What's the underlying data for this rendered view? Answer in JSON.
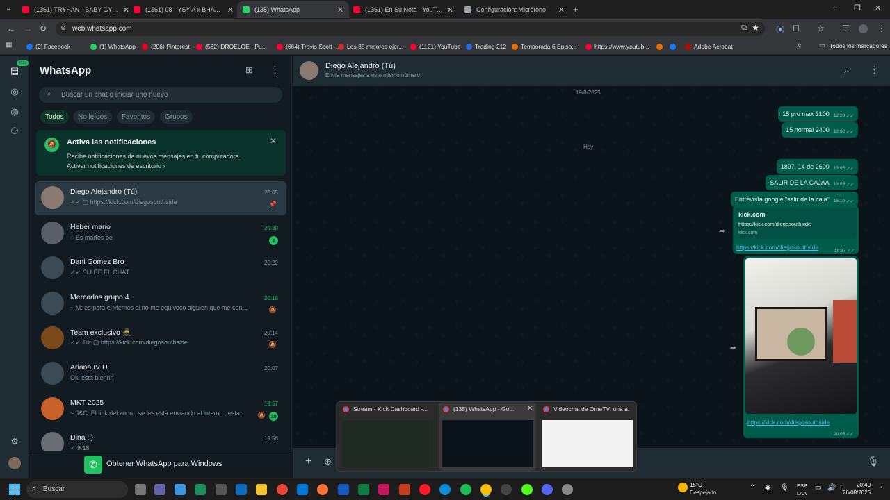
{
  "browser": {
    "tabs": [
      {
        "title": "(1361) TRYHAN - BABY GYAL F",
        "icon": "youtube-icon",
        "color": "#ff0033"
      },
      {
        "title": "(1361) 08 - YSY A x BHAVI ft. M",
        "icon": "youtube-icon",
        "color": "#ff0033"
      },
      {
        "title": "(135) WhatsApp",
        "icon": "whatsapp-icon",
        "color": "#25d366"
      },
      {
        "title": "(1361) En Su Nota - YouTub",
        "icon": "youtube-icon",
        "color": "#ff0033"
      },
      {
        "title": "Configuración: Micrófono",
        "icon": "settings-icon",
        "color": "#9aa0a6"
      }
    ],
    "new_tab": "+",
    "url": "web.whatsapp.com",
    "bookmarks": [
      {
        "label": "(2) Facebook",
        "color": "#1877f2"
      },
      {
        "label": "(1) WhatsApp",
        "color": "#25d366"
      },
      {
        "label": "(206) Pinterest",
        "color": "#e60023"
      },
      {
        "label": "(582) DROELOE - Pu...",
        "color": "#ff0033"
      },
      {
        "label": "(664) Travis Scott -...",
        "color": "#ff0033"
      },
      {
        "label": "Los 35 mejores ejer...",
        "color": "#c4302b"
      },
      {
        "label": "(1121) YouTube",
        "color": "#ff0033"
      },
      {
        "label": "Trading 212",
        "color": "#2d6be4"
      },
      {
        "label": "Temporada 6 Episo...",
        "color": "#e8710a"
      },
      {
        "label": "https://www.youtub...",
        "color": "#ff0033"
      },
      {
        "label": "",
        "color": "#e8710a"
      },
      {
        "label": "",
        "color": "#1877f2"
      },
      {
        "label": "Adobe Acrobat",
        "color": "#b30b00"
      }
    ],
    "bookmarks_more": "»",
    "all_bookmarks": "Todos los marcadores"
  },
  "rail": {
    "badge": "Más"
  },
  "sidebar": {
    "title": "WhatsApp",
    "search_placeholder": "Buscar un chat o iniciar uno nuevo",
    "filters": [
      "Todos",
      "No leídos",
      "Favoritos",
      "Grupos"
    ],
    "notification": {
      "title": "Activa las notificaciones",
      "body": "Recibe notificaciones de nuevos mensajes en tu computadora.",
      "link": "Activar notificaciones de escritorio"
    },
    "chats": [
      {
        "name": "Diego Alejandro (Tú)",
        "preview": "✓✓ ▢ https://kick.com/diegosouthside",
        "time": "20:05",
        "time_green": false,
        "badge": "",
        "muted": false,
        "pinned": true,
        "avatar": "#8a7a72"
      },
      {
        "name": "Heber mano",
        "preview": "◌ Es martes oe",
        "time": "20:30",
        "time_green": true,
        "badge": "2",
        "muted": false,
        "pinned": false,
        "avatar": "#5a5f6a"
      },
      {
        "name": "Dani Gomez Bro",
        "preview": "✓✓ SI LEE EL CHAT",
        "time": "20:22",
        "time_green": false,
        "badge": "",
        "muted": false,
        "pinned": false,
        "avatar": "#3b4a54"
      },
      {
        "name": "Mercados grupo 4",
        "preview": "~ M: es para el viernes si no me equivoco alguien que me con...",
        "time": "20:18",
        "time_green": true,
        "badge": "",
        "muted": true,
        "pinned": false,
        "avatar": "#3b4a54"
      },
      {
        "name": "Team exclusivo 🥷",
        "preview": "✓✓ Tú: ▢ https://kick.com/diegosouthside",
        "time": "20:14",
        "time_green": false,
        "badge": "",
        "muted": true,
        "pinned": false,
        "avatar": "#7a4a1a"
      },
      {
        "name": "Ariana IV U",
        "preview": "Oki esta biennn",
        "time": "20:07",
        "time_green": false,
        "badge": "",
        "muted": false,
        "pinned": false,
        "avatar": "#3b4a54"
      },
      {
        "name": "MKT 2025",
        "preview": "~ J&C: El link del zoom, se les está enviando al interno , esta...",
        "time": "19:57",
        "time_green": true,
        "badge": "20",
        "muted": true,
        "pinned": false,
        "avatar": "#c8622a"
      },
      {
        "name": "Dina :')",
        "preview": "✓ 9:18",
        "time": "19:56",
        "time_green": false,
        "badge": "",
        "muted": false,
        "pinned": false,
        "avatar": "#6a6f75"
      }
    ],
    "get_app": "Obtener WhatsApp para Windows"
  },
  "conversation": {
    "contact": "Diego Alejandro (Tú)",
    "subtitle": "Envía mensajes a este mismo número.",
    "date1": "19/8/2025",
    "date2": "Hoy",
    "messages": [
      {
        "text": "15 pro max 3100",
        "time": "12:28"
      },
      {
        "text": "15 normal 2400",
        "time": "12:32"
      },
      {
        "text": "1897. 14 de 2600",
        "time": "13:05"
      },
      {
        "text": "SALIR DE LA CAJAA",
        "time": "13:05"
      },
      {
        "text": "Entrevista google \"salir de la caja\"",
        "time": "15:10"
      }
    ],
    "link_card": {
      "site": "kick.com",
      "url": "https://kick.com/diegosouthside",
      "domain": "kick.com",
      "link": "https://kick.com/diegosouthside",
      "time": "19:37"
    },
    "image_msg": {
      "link": "https://kick.com/diegosouthside",
      "time": "20:05"
    }
  },
  "previews": [
    {
      "title": "Stream - Kick Dashboard -..."
    },
    {
      "title": "(135) WhatsApp - Go..."
    },
    {
      "title": "Videochat de OmeTV: una a..."
    }
  ],
  "taskbar": {
    "search": "Buscar",
    "weather_temp": "15°C",
    "weather_desc": "Despejado",
    "lang1": "ESP",
    "lang2": "LAA",
    "time": "20:40",
    "date": "26/08/2025"
  }
}
